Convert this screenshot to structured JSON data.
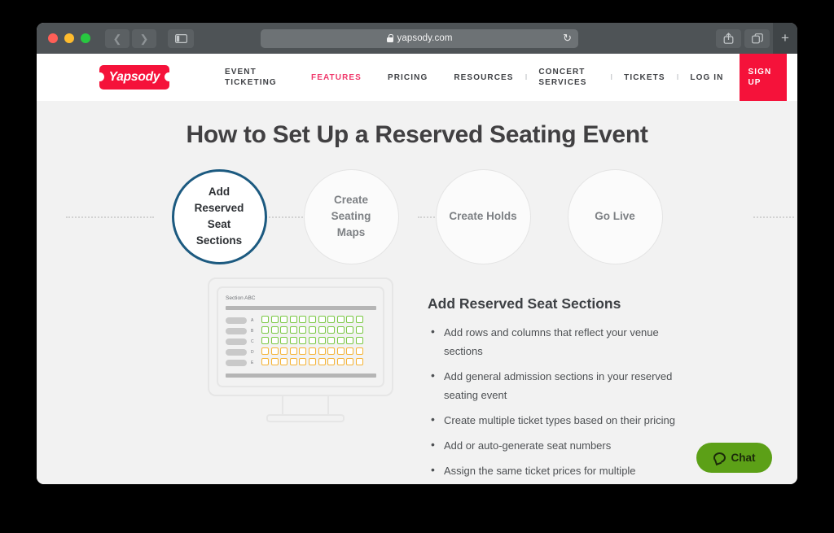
{
  "browser": {
    "url": "yapsody.com",
    "lock_icon": "lock-icon",
    "reload_icon": "reload-icon",
    "back_icon": "chevron-left-icon",
    "forward_icon": "chevron-right-icon",
    "sidebar_icon": "sidebar-icon",
    "share_icon": "share-icon",
    "tabs_icon": "tabs-icon",
    "new_tab_icon": "plus-icon"
  },
  "site_nav": {
    "logo_text": "Yapsody",
    "logo_color": "#f5123a",
    "active_color": "#f0386b",
    "links": [
      {
        "label": "EVENT TICKETING",
        "active": false
      },
      {
        "label": "FEATURES",
        "active": true
      },
      {
        "label": "PRICING",
        "active": false
      },
      {
        "label": "RESOURCES",
        "active": false
      },
      {
        "label": "CONCERT SERVICES",
        "active": false
      },
      {
        "label": "TICKETS",
        "active": false
      },
      {
        "label": "LOG IN",
        "active": false
      }
    ],
    "divider": "I",
    "signup_label": "SIGN UP"
  },
  "page": {
    "headline": "How to Set Up a Reserved Seating Event",
    "steps": [
      {
        "label": "Add Reserved Seat Sections",
        "active": true
      },
      {
        "label": "Create Seating Maps",
        "active": false
      },
      {
        "label": "Create Holds",
        "active": false
      },
      {
        "label": "Go Live",
        "active": false
      }
    ],
    "active_step_color": "#1c5a80",
    "illustration": {
      "section_label": "Section ABC",
      "row_labels": [
        "A",
        "B",
        "C",
        "D",
        "E"
      ],
      "seats_per_row": 11,
      "row_colors": [
        "green",
        "green",
        "green",
        "amber",
        "amber"
      ],
      "green": "#7ac943",
      "amber": "#f5b335"
    },
    "subhead": "Add Reserved Seat Sections",
    "bullets": [
      "Add rows and columns that reflect your venue sections",
      "Add general admission sections in your reserved seating event",
      "Create multiple ticket types based on their pricing",
      "Add or auto-generate seat numbers",
      "Assign the same ticket prices for multiple performances"
    ]
  },
  "chat": {
    "label": "Chat",
    "icon": "chat-bubble-icon",
    "color": "#5ca017"
  }
}
